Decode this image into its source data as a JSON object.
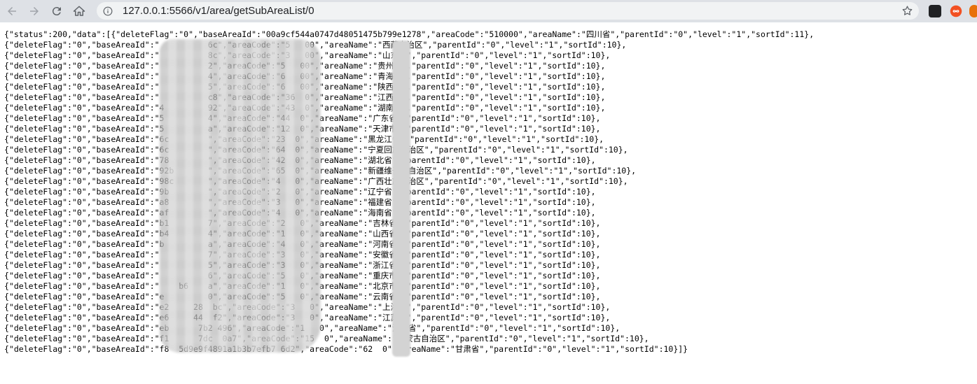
{
  "browser": {
    "url": "127.0.0.1:5566/v1/area/getSubAreaList/0"
  },
  "icons": {
    "back": "back-arrow-icon",
    "forward": "forward-arrow-icon",
    "reload": "reload-icon",
    "home": "home-icon",
    "info": "info-icon",
    "star": "bookmark-star-icon"
  },
  "json_lines": [
    "{\"status\":200,\"data\":[{\"deleteFlag\":\"0\",\"baseAreaId\":\"00a9cf544a0747d48051475b799e1278\",\"areaCode\":\"510000\",\"areaName\":\"四川省\",\"parentId\":\"0\",\"level\":\"1\",\"sortId\":11},",
    "{\"deleteFlag\":\"0\",\"baseAreaId\":\"          6c\",\"areaCode\":\"5   00\",\"areaName\":\"西藏自治区\",\"parentId\":\"0\",\"level\":\"1\",\"sortId\":10},",
    "{\"deleteFlag\":\"0\",\"baseAreaId\":\"          8c\",\"areaCode\":\"3   00\",\"areaName\":\"山东省\",\"parentId\":\"0\",\"level\":\"1\",\"sortId\":10},",
    "{\"deleteFlag\":\"0\",\"baseAreaId\":\"          2\",\"areaCode\":\"5   00\",\"areaName\":\"贵州省\",\"parentId\":\"0\",\"level\":\"1\",\"sortId\":10},",
    "{\"deleteFlag\":\"0\",\"baseAreaId\":\"          4\",\"areaCode\":\"6   00\",\"areaName\":\"青海省\",\"parentId\":\"0\",\"level\":\"1\",\"sortId\":10},",
    "{\"deleteFlag\":\"0\",\"baseAreaId\":\"          5\",\"areaCode\":\"6   00\",\"areaName\":\"陕西省\",\"parentId\":\"0\",\"level\":\"1\",\"sortId\":10},",
    "{\"deleteFlag\":\"0\",\"baseAreaId\":\"          c8\",\"areaCode\":\"36  0\",\"areaName\":\"江西省\",\"parentId\":\"0\",\"level\":\"1\",\"sortId\":10},",
    "{\"deleteFlag\":\"0\",\"baseAreaId\":\"4         92\",\"areaCode\":\"43  0\",\"areaName\":\"湖南省\",\"parentId\":\"0\",\"level\":\"1\",\"sortId\":10},",
    "{\"deleteFlag\":\"0\",\"baseAreaId\":\"5         4\",\"areaCode\":\"44  0\",\"areaName\":\"广东省\",\"parentId\":\"0\",\"level\":\"1\",\"sortId\":10},",
    "{\"deleteFlag\":\"0\",\"baseAreaId\":\"5         a\",\"areaCode\":\"12  0\",\"areaName\":\"天津市\",\"parentId\":\"0\",\"level\":\"1\",\"sortId\":10},",
    "{\"deleteFlag\":\"0\",\"baseAreaId\":\"6c        \",\"areaCode\":\"23  0\",\"areaName\":\"黑龙江省\",\"parentId\":\"0\",\"level\":\"1\",\"sortId\":10},",
    "{\"deleteFlag\":\"0\",\"baseAreaId\":\"6c        \",\"areaCode\":\"64  0\",\"areaName\":\"宁夏回族自治区\",\"parentId\":\"0\",\"level\":\"1\",\"sortId\":10},",
    "{\"deleteFlag\":\"0\",\"baseAreaId\":\"78        \",\"areaCode\":\"42  0\",\"areaName\":\"湖北省\",\"parentId\":\"0\",\"level\":\"1\",\"sortId\":10},",
    "{\"deleteFlag\":\"0\",\"baseAreaId\":\"92b       \",\"areaCode\":\"65  0\",\"areaName\":\"新疆维吾尔自治区\",\"parentId\":\"0\",\"level\":\"1\",\"sortId\":10},",
    "{\"deleteFlag\":\"0\",\"baseAreaId\":\"98c       \",\"areaCode\":\"4   0\",\"areaName\":\"广西壮族自治区\",\"parentId\":\"0\",\"level\":\"1\",\"sortId\":10},",
    "{\"deleteFlag\":\"0\",\"baseAreaId\":\"9b        \",\"areaCode\":\"2   0\",\"areaName\":\"辽宁省\",\"parentId\":\"0\",\"level\":\"1\",\"sortId\":10},",
    "{\"deleteFlag\":\"0\",\"baseAreaId\":\"a8        \",\"areaCode\":\"3   0\",\"areaName\":\"福建省\",\"parentId\":\"0\",\"level\":\"1\",\"sortId\":10},",
    "{\"deleteFlag\":\"0\",\"baseAreaId\":\"af        \",\"areaCode\":\"4   0\",\"areaName\":\"海南省\",\"parentId\":\"0\",\"level\":\"1\",\"sortId\":10},",
    "{\"deleteFlag\":\"0\",\"baseAreaId\":\"b1        7\",\"areaCode\":\"2   0\",\"areaName\":\"吉林省\",\"parentId\":\"0\",\"level\":\"1\",\"sortId\":10},",
    "{\"deleteFlag\":\"0\",\"baseAreaId\":\"b4        4\",\"areaCode\":\"1   0\",\"areaName\":\"山西省\",\"parentId\":\"0\",\"level\":\"1\",\"sortId\":10},",
    "{\"deleteFlag\":\"0\",\"baseAreaId\":\"b         a\",\"areaCode\":\"4   0\",\"areaName\":\"河南省\",\"parentId\":\"0\",\"level\":\"1\",\"sortId\":10},",
    "{\"deleteFlag\":\"0\",\"baseAreaId\":\"          7\",\"areaCode\":\"3   0\",\"areaName\":\"安徽省\",\"parentId\":\"0\",\"level\":\"1\",\"sortId\":10},",
    "{\"deleteFlag\":\"0\",\"baseAreaId\":\"          5\",\"areaCode\":\"3   0\",\"areaName\":\"浙江省\",\"parentId\":\"0\",\"level\":\"1\",\"sortId\":10},",
    "{\"deleteFlag\":\"0\",\"baseAreaId\":\"          6\",\"areaCode\":\"5   0\",\"areaName\":\"重庆市\",\"parentId\":\"0\",\"level\":\"1\",\"sortId\":10},",
    "{\"deleteFlag\":\"0\",\"baseAreaId\":\"    b6    a\",\"areaCode\":\"1   0\",\"areaName\":\"北京市\",\"parentId\":\"0\",\"level\":\"1\",\"sortId\":10},",
    "{\"deleteFlag\":\"0\",\"baseAreaId\":\"e         0\",\"areaCode\":\"5   0\",\"areaName\":\"云南省\",\"parentId\":\"0\",\"level\":\"1\",\"sortId\":10},",
    "{\"deleteFlag\":\"0\",\"baseAreaId\":\"e2     28  bc\",\"areaCode\":\"3   0\",\"areaName\":\"上海市\",\"parentId\":\"0\",\"level\":\"1\",\"sortId\":10},",
    "{\"deleteFlag\":\"0\",\"baseAreaId\":\"e6     44  f2\",\"areaCode\":\"3   0\",\"areaName\":\"江苏省\",\"parentId\":\"0\",\"level\":\"1\",\"sortId\":10},",
    "{\"deleteFlag\":\"0\",\"baseAreaId\":\"eb      7b2 496\",\"areaCode\":\"1   0\",\"areaName\":\"河北省\",\"parentId\":\"0\",\"level\":\"1\",\"sortId\":10},",
    "{\"deleteFlag\":\"0\",\"baseAreaId\":\"f1      7dc  0a7\",\"areaCode\":\"15  0\",\"areaName\":\"内蒙古自治区\",\"parentId\":\"0\",\"level\":\"1\",\"sortId\":10},",
    "{\"deleteFlag\":\"0\",\"baseAreaId\":\"f8  5d9e9f4891a1b3b7efb7 6d2\",\"areaCode\":\"62  0\",\"areaName\":\"甘肃省\",\"parentId\":\"0\",\"level\":\"1\",\"sortId\":10}]}"
  ]
}
